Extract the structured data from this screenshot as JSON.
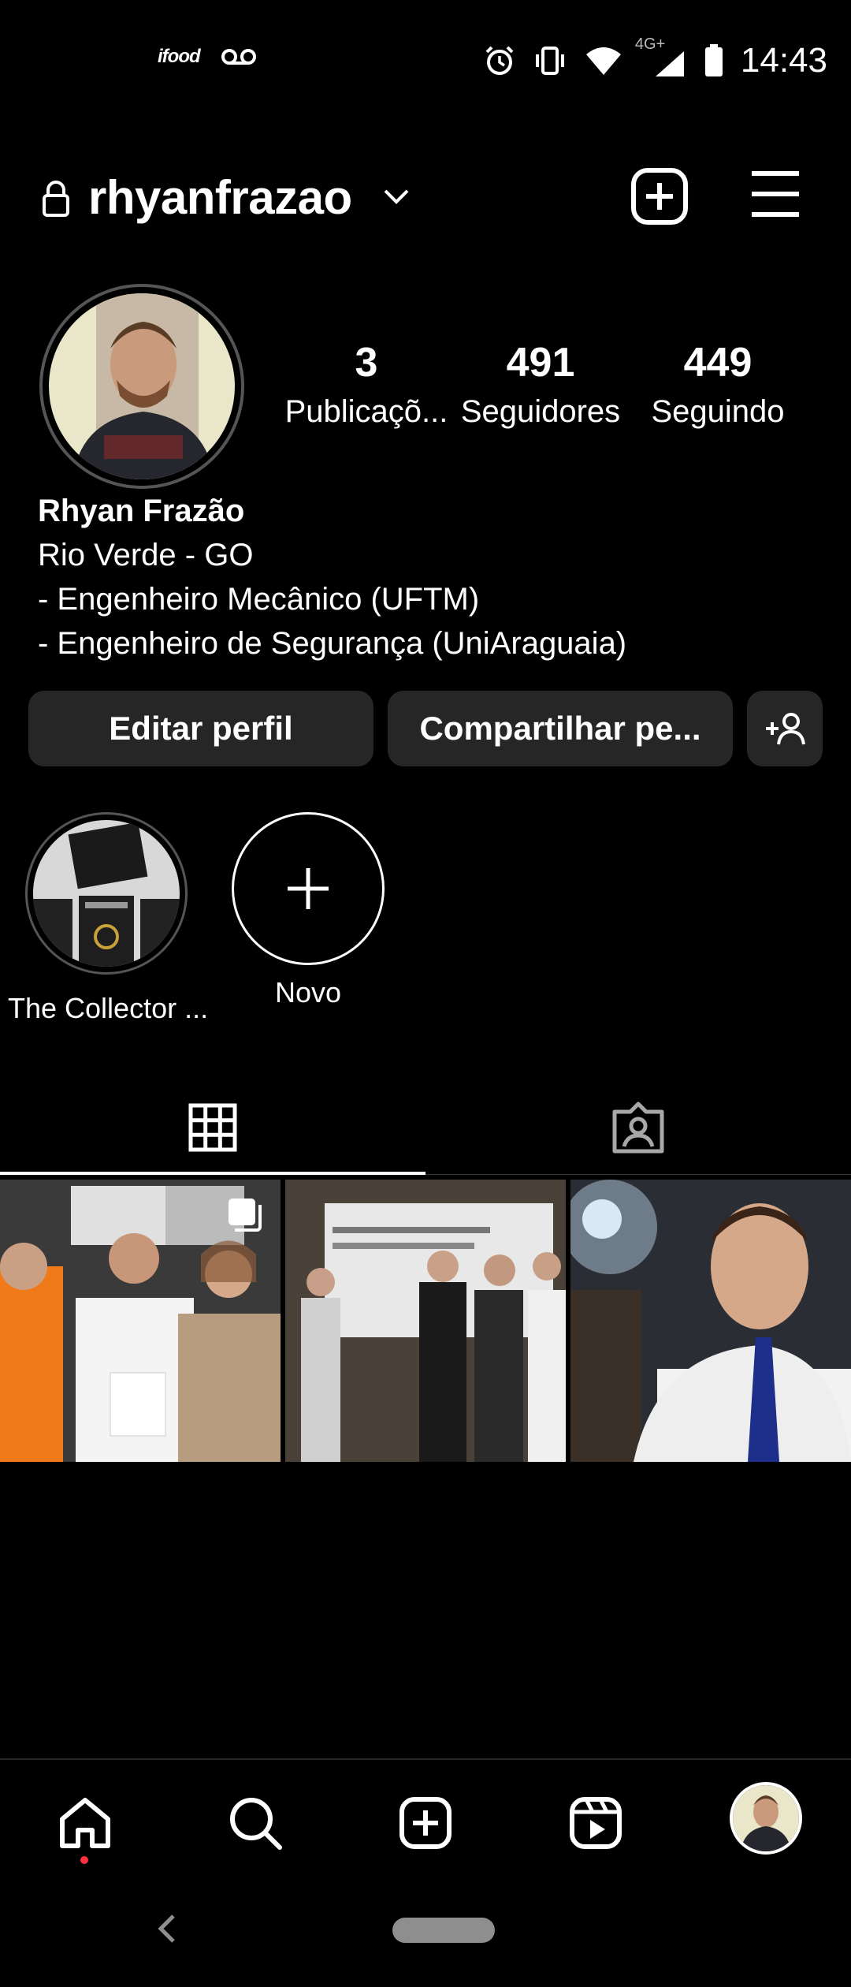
{
  "status_bar": {
    "time": "14:43",
    "network": "4G+",
    "icons": [
      "ifood-notification-icon",
      "voicemail-icon",
      "alarm-icon",
      "vibrate-icon",
      "wifi-icon",
      "signal-icon",
      "battery-icon"
    ],
    "ifood_label": "ifood"
  },
  "header": {
    "username": "rhyanfrazao",
    "icons": [
      "lock-icon",
      "chevron-down-icon",
      "new-post-icon",
      "menu-icon"
    ]
  },
  "stats": {
    "posts": {
      "count": "3",
      "label": "Publicaçõ..."
    },
    "followers": {
      "count": "491",
      "label": "Seguidores"
    },
    "following": {
      "count": "449",
      "label": "Seguindo"
    }
  },
  "bio": {
    "name": "Rhyan Frazão",
    "lines": [
      "Rio Verde - GO",
      "- Engenheiro Mecânico (UFTM)",
      "- Engenheiro de Segurança (UniAraguaia)"
    ]
  },
  "actions": {
    "edit_label": "Editar perfil",
    "share_label": "Compartilhar pe...",
    "add_person_icon": "add-person-icon"
  },
  "highlights": [
    {
      "label": "The Collector ..."
    },
    {
      "label": "Novo"
    }
  ],
  "tabs": [
    {
      "icon": "grid-icon",
      "active": true
    },
    {
      "icon": "tagged-icon",
      "active": false
    }
  ],
  "posts_count_visible": 3,
  "bottom_nav": [
    "home-icon",
    "search-icon",
    "create-icon",
    "reels-icon",
    "profile-avatar"
  ],
  "colors": {
    "background": "#000000",
    "button": "#262626",
    "notification_dot": "#ff3040",
    "text": "#ffffff"
  }
}
